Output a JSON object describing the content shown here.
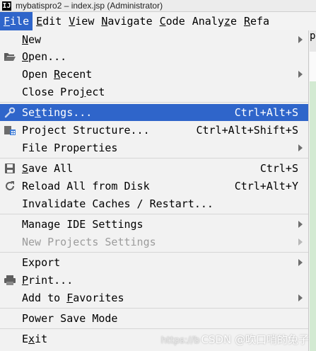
{
  "window": {
    "title": "mybatispro2 – index.jsp (Administrator)",
    "app_icon_text": "IJ"
  },
  "menubar": [
    {
      "name": "file",
      "pre": "",
      "mnem": "F",
      "post": "ile",
      "active": true
    },
    {
      "name": "edit",
      "pre": "",
      "mnem": "E",
      "post": "dit"
    },
    {
      "name": "view",
      "pre": "",
      "mnem": "V",
      "post": "iew"
    },
    {
      "name": "navigate",
      "pre": "",
      "mnem": "N",
      "post": "avigate"
    },
    {
      "name": "code",
      "pre": "",
      "mnem": "C",
      "post": "ode"
    },
    {
      "name": "analyze",
      "pre": "Analy",
      "mnem": "z",
      "post": "e"
    },
    {
      "name": "refactor",
      "pre": "",
      "mnem": "R",
      "post": "efa"
    }
  ],
  "editor_tab_text": "p",
  "file_menu": {
    "new": {
      "pre": "",
      "mnem": "N",
      "post": "ew"
    },
    "open": {
      "pre": "",
      "mnem": "O",
      "post": "pen..."
    },
    "open_recent": {
      "pre": "Open ",
      "mnem": "R",
      "post": "ecent"
    },
    "close_project": {
      "pre": "Close Pro",
      "mnem": "j",
      "post": "ect"
    },
    "settings": {
      "pre": "Se",
      "mnem": "t",
      "post": "tings...",
      "shortcut": "Ctrl+Alt+S"
    },
    "project_structure": {
      "pre": "Project Structure...",
      "mnem": "",
      "post": "",
      "shortcut": "Ctrl+Alt+Shift+S"
    },
    "file_properties": {
      "pre": "File Properties",
      "mnem": "",
      "post": ""
    },
    "save_all": {
      "pre": "",
      "mnem": "S",
      "post": "ave All",
      "shortcut": "Ctrl+S"
    },
    "reload_all": {
      "pre": "Reload All from Disk",
      "mnem": "",
      "post": "",
      "shortcut": "Ctrl+Alt+Y"
    },
    "invalidate_caches": {
      "pre": "Invalidate Caches / Restart...",
      "mnem": "",
      "post": ""
    },
    "manage_ide_settings": {
      "pre": "Manage IDE Settings",
      "mnem": "",
      "post": ""
    },
    "new_projects_settings": {
      "pre": "New Projects Settings",
      "mnem": "",
      "post": ""
    },
    "export": {
      "pre": "Export",
      "mnem": "",
      "post": ""
    },
    "print": {
      "pre": "",
      "mnem": "P",
      "post": "rint..."
    },
    "add_to_favorites": {
      "pre": "Add to ",
      "mnem": "F",
      "post": "avorites"
    },
    "power_save_mode": {
      "pre": "Power Save Mode",
      "mnem": "",
      "post": ""
    },
    "exit": {
      "pre": "E",
      "mnem": "x",
      "post": "it"
    }
  },
  "watermark": {
    "url": "https://b",
    "text": "CSDN @吹口哨的兔子"
  },
  "colors": {
    "selection": "#2f65ca",
    "menu_bg": "#f2f2f2",
    "disabled_text": "#9c9c9c"
  }
}
